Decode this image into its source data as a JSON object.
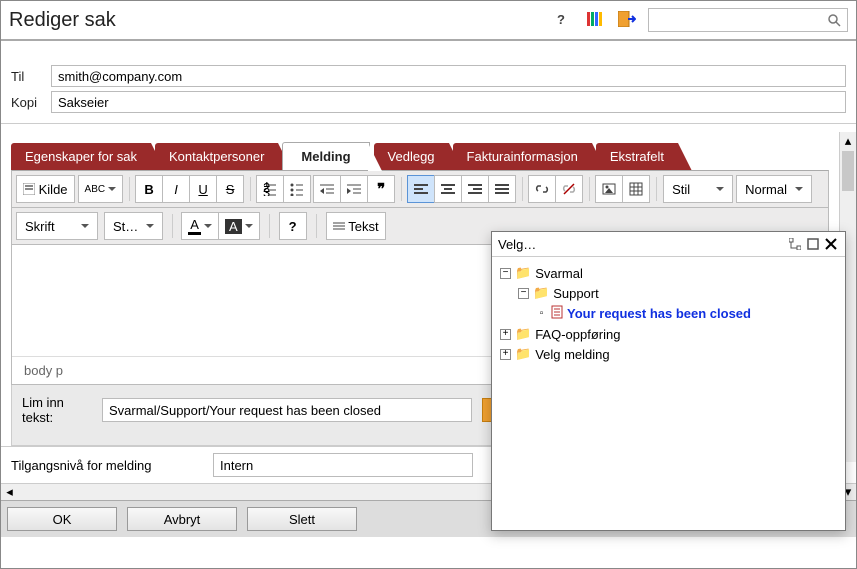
{
  "title": "Rediger sak",
  "header": {
    "to_label": "Til",
    "to_value": "smith@company.com",
    "cc_label": "Kopi",
    "cc_value": "Sakseier"
  },
  "tabs": [
    "Egenskaper for sak",
    "Kontaktpersoner",
    "Melding",
    "Vedlegg",
    "Fakturainformasjon",
    "Ekstrafelt"
  ],
  "active_tab_index": 2,
  "toolbar": {
    "source": "Kilde",
    "abc": "ABC",
    "style": "Stil",
    "paragraph": "Normal",
    "font": "Skrift",
    "size": "St…",
    "a_fg": "A",
    "a_bg": "A",
    "tekst": "Tekst"
  },
  "editor_path": "body   p",
  "paste": {
    "label_line1": "Lim inn",
    "label_line2": "tekst:",
    "value": "Svarmal/Support/Your request has been closed"
  },
  "access": {
    "label": "Tilgangsnivå for melding",
    "value": "Intern"
  },
  "footer": {
    "ok": "OK",
    "cancel": "Avbryt",
    "delete": "Slett"
  },
  "popup": {
    "title": "Velg…",
    "tree": {
      "root": "Svarmal",
      "child1": "Support",
      "leaf": "Your request has been closed",
      "faq": "FAQ-oppføring",
      "velg": "Velg melding"
    }
  }
}
